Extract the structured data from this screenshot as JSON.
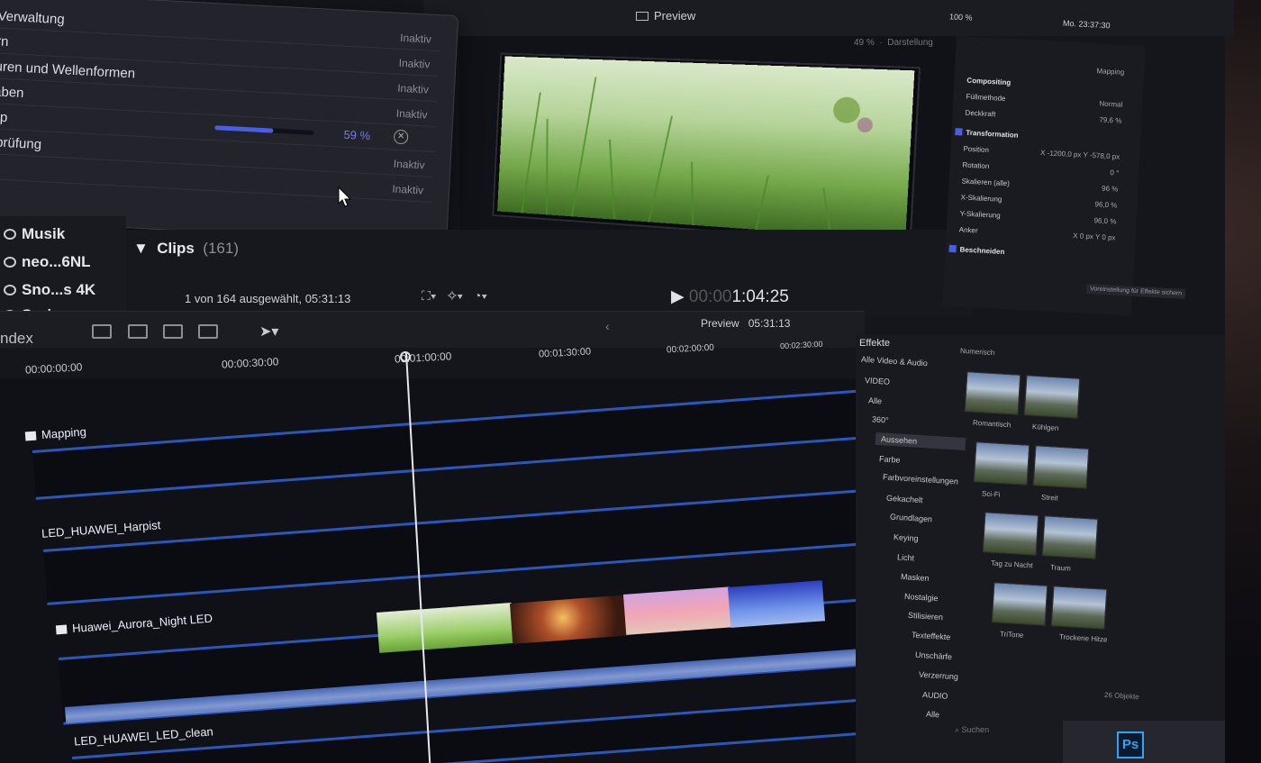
{
  "menubar": {
    "window_title": "Preview",
    "status": "100 %",
    "clock": "Mo. 23:37:30"
  },
  "tasks": {
    "rows": [
      {
        "label": "Verwaltung",
        "status": "Inaktiv"
      },
      {
        "label": "rn",
        "status": "Inaktiv"
      },
      {
        "label": "uren und Wellenformen",
        "status": "Inaktiv"
      },
      {
        "label": "aben",
        "status": "Inaktiv"
      },
      {
        "label": "up",
        "progress": 0.59,
        "percent": "59 %"
      },
      {
        "label": "rprüfung",
        "status": "Inaktiv"
      },
      {
        "label": "",
        "status": "Inaktiv"
      }
    ]
  },
  "viewer": {
    "zoom": "49 %",
    "view_menu": "Darstellung"
  },
  "library": {
    "items": [
      {
        "label": "Musik"
      },
      {
        "label": "neo...6NL"
      },
      {
        "label": "Sno...s 4K"
      },
      {
        "label": "Spring"
      }
    ]
  },
  "browser": {
    "title": "Clips",
    "count": "(161)",
    "selection": "1 von 164 ausgewählt, 05:31:13"
  },
  "timecode": {
    "dim": "00:00",
    "value": "1:04:25"
  },
  "inspector": {
    "tab": "Mapping",
    "compositing": "Compositing",
    "fill_mode_label": "Füllmethode",
    "fill_mode": "Normal",
    "opacity_label": "Deckkraft",
    "opacity": "79,6 %",
    "transform": "Transformation",
    "position_label": "Position",
    "position": "X -1200,0 px   Y -578,0 px",
    "rotation_label": "Rotation",
    "rotation": "0 °",
    "scale_all_label": "Skalieren (alle)",
    "scale_all": "96 %",
    "scale_x_label": "X-Skalierung",
    "scale_x": "96,0 %",
    "scale_y_label": "Y-Skalierung",
    "scale_y": "96,0 %",
    "anchor_label": "Anker",
    "anchor": "X 0 px  Y 0 px",
    "crop": "Beschneiden",
    "tooltip": "Voreinstellung für Effekte sichern"
  },
  "timeline": {
    "index_label": "ndex",
    "title": "Preview",
    "duration": "05:31:13",
    "ruler": [
      "00:00:00:00",
      "00:00:30:00",
      "00:01:00:00",
      "00:01:30:00",
      "00:02:00:00",
      "00:02:30:00"
    ],
    "tracks": [
      {
        "name": "Mapping"
      },
      {
        "name": "LED_HUAWEI_Harpist"
      },
      {
        "name": "Huawei_Aurora_Night LED"
      },
      {
        "name": "LED_HUAWEI_LED_clean"
      }
    ]
  },
  "effects": {
    "title": "Effekte",
    "sort_label": "Numerisch",
    "categories": [
      "Alle Video & Audio",
      "VIDEO",
      "Alle",
      "360°",
      "Aussehen",
      "Farbe",
      "Farbvoreinstellungen",
      "Gekachelt",
      "Grundlagen",
      "Keying",
      "Licht",
      "Masken",
      "Nostalgie",
      "Stilisieren",
      "Texteffekte",
      "Unschärfe",
      "Verzerrung",
      "AUDIO",
      "Alle"
    ],
    "selected_category": "Aussehen",
    "presets": [
      "Romantisch",
      "Kühlgen",
      "Sci-Fi",
      "Streit",
      "Tag zu Nacht",
      "Traum",
      "TriTone",
      "Trockene Hitze"
    ],
    "count": "26 Objekte",
    "search_placeholder": "Suchen"
  },
  "dock": {
    "ps_label": "Ps"
  },
  "colors": {
    "accent": "#4a5fe0",
    "track_border": "#2a57b8",
    "progress": "#4a5fe0"
  }
}
